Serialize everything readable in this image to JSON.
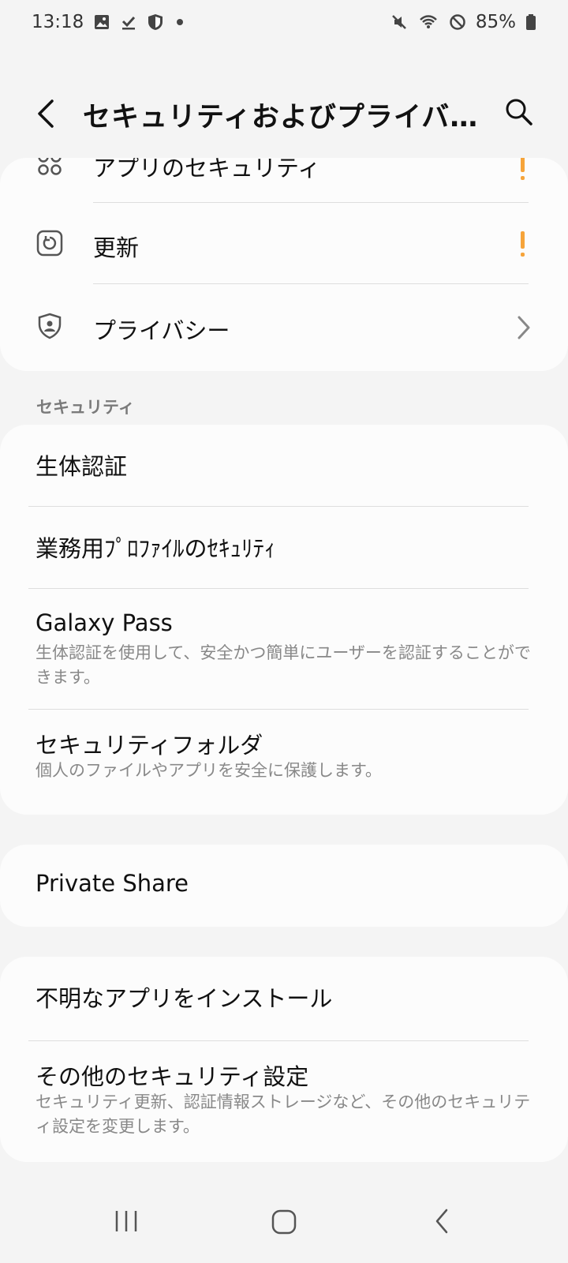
{
  "status_bar": {
    "time": "13:18",
    "battery": "85%",
    "left_icons": [
      "image-icon",
      "download-done-icon",
      "shield-icon",
      "notification-dot"
    ],
    "right_icons": [
      "mute-icon",
      "wifi-icon",
      "do-not-disturb-icon",
      "battery-icon"
    ]
  },
  "app_bar": {
    "title": "セキュリティおよびプライバ…",
    "back_icon": "back-arrow-icon",
    "search_icon": "search-icon"
  },
  "top_card": {
    "items": [
      {
        "label": "アプリのセキュリティ",
        "icon": "apps-grid-icon",
        "trailing": "warning"
      },
      {
        "label": "更新",
        "icon": "update-icon",
        "trailing": "warning"
      },
      {
        "label": "プライバシー",
        "icon": "privacy-shield-icon",
        "trailing": "chevron"
      }
    ]
  },
  "security_section": {
    "header": "セキュリティ",
    "items": [
      {
        "title": "生体認証",
        "subtitle": ""
      },
      {
        "title": "業務用ﾌﾟﾛﾌｧｲﾙのｾｷｭﾘﾃｨ",
        "subtitle": ""
      },
      {
        "title": "Galaxy Pass",
        "subtitle": "生体認証を使用して、安全かつ簡単にユーザーを認証することができます。"
      },
      {
        "title": "セキュリティフォルダ",
        "subtitle": "個人のファイルやアプリを安全に保護します。"
      }
    ]
  },
  "private_share": {
    "title": "Private Share"
  },
  "other_card": {
    "items": [
      {
        "title": "不明なアプリをインストール",
        "subtitle": ""
      },
      {
        "title": "その他のセキュリティ設定",
        "subtitle": "セキュリティ更新、認証情報ストレージなど、その他のセキュリティ設定を変更します。"
      }
    ]
  },
  "nav_bar": {
    "icons": [
      "recent-apps-icon",
      "home-icon",
      "back-icon"
    ]
  },
  "colors": {
    "warning": "#f6a43a",
    "card": "#fcfcfc",
    "background": "#f4f4f4",
    "subtitle": "#888888"
  }
}
